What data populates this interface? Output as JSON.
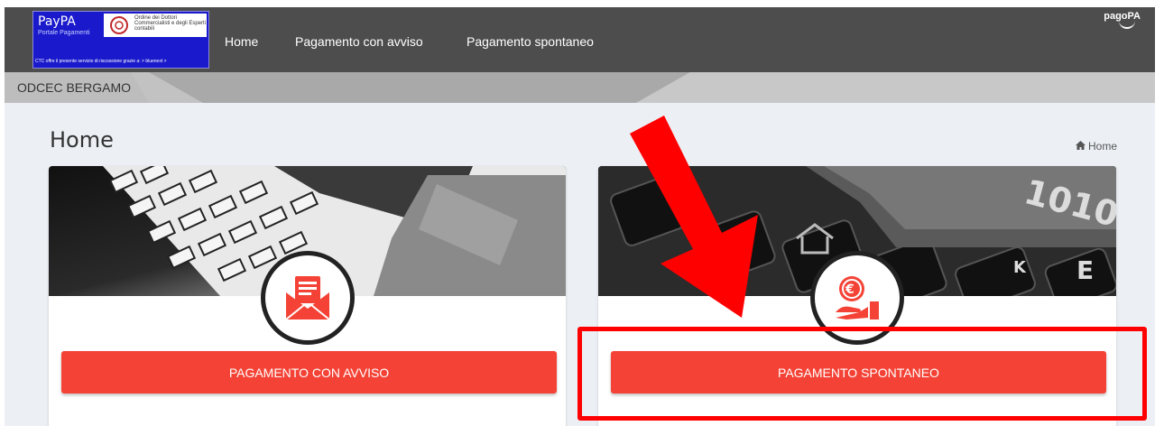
{
  "logo": {
    "title": "PayPA",
    "subtitle": "Portale Pagamenti",
    "institution": "Ordine dei Dottori Commercialisti e degli Esperti contabili",
    "footer": "CTC offre il presente servizio di riscossione grazie a: > bluenext >"
  },
  "nav": {
    "home": "Home",
    "pagamento_con_avviso": "Pagamento con avviso",
    "pagamento_spontaneo": "Pagamento spontaneo",
    "pagopa": "pagoPA"
  },
  "org": {
    "name": "ODCEC BERGAMO"
  },
  "page": {
    "title": "Home"
  },
  "breadcrumb": {
    "icon": "home-icon",
    "label": "Home"
  },
  "cards": [
    {
      "icon": "envelope-document-icon",
      "button_label": "PAGAMENTO CON AVVISO"
    },
    {
      "icon": "hand-euro-coin-icon",
      "button_label": "PAGAMENTO SPONTANEO"
    }
  ],
  "annotation": {
    "arrow_color": "#ff0000",
    "highlight_color": "#ff0000"
  },
  "colors": {
    "accent": "#f44336",
    "navbar": "#4d4d4d",
    "orgbar": "#c2c2c2",
    "logo": "#1a1acc"
  }
}
